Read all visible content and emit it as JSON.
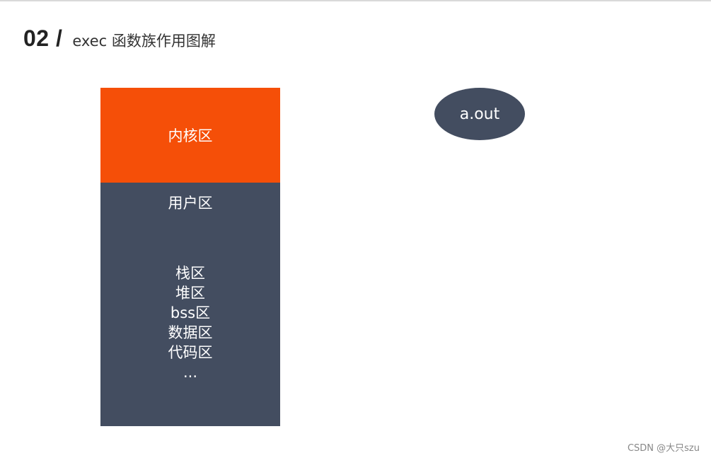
{
  "header": {
    "number": "02 /",
    "title": "exec 函数族作用图解"
  },
  "memory": {
    "kernel_label": "内核区",
    "user_label": "用户区",
    "segments": [
      "栈区",
      "堆区",
      "bss区",
      "数据区",
      "代码区",
      "..."
    ]
  },
  "program": {
    "label": "a.out"
  },
  "watermark": "CSDN @大只szu",
  "colors": {
    "kernel": "#f54f08",
    "user": "#434d60",
    "program": "#434d60"
  }
}
